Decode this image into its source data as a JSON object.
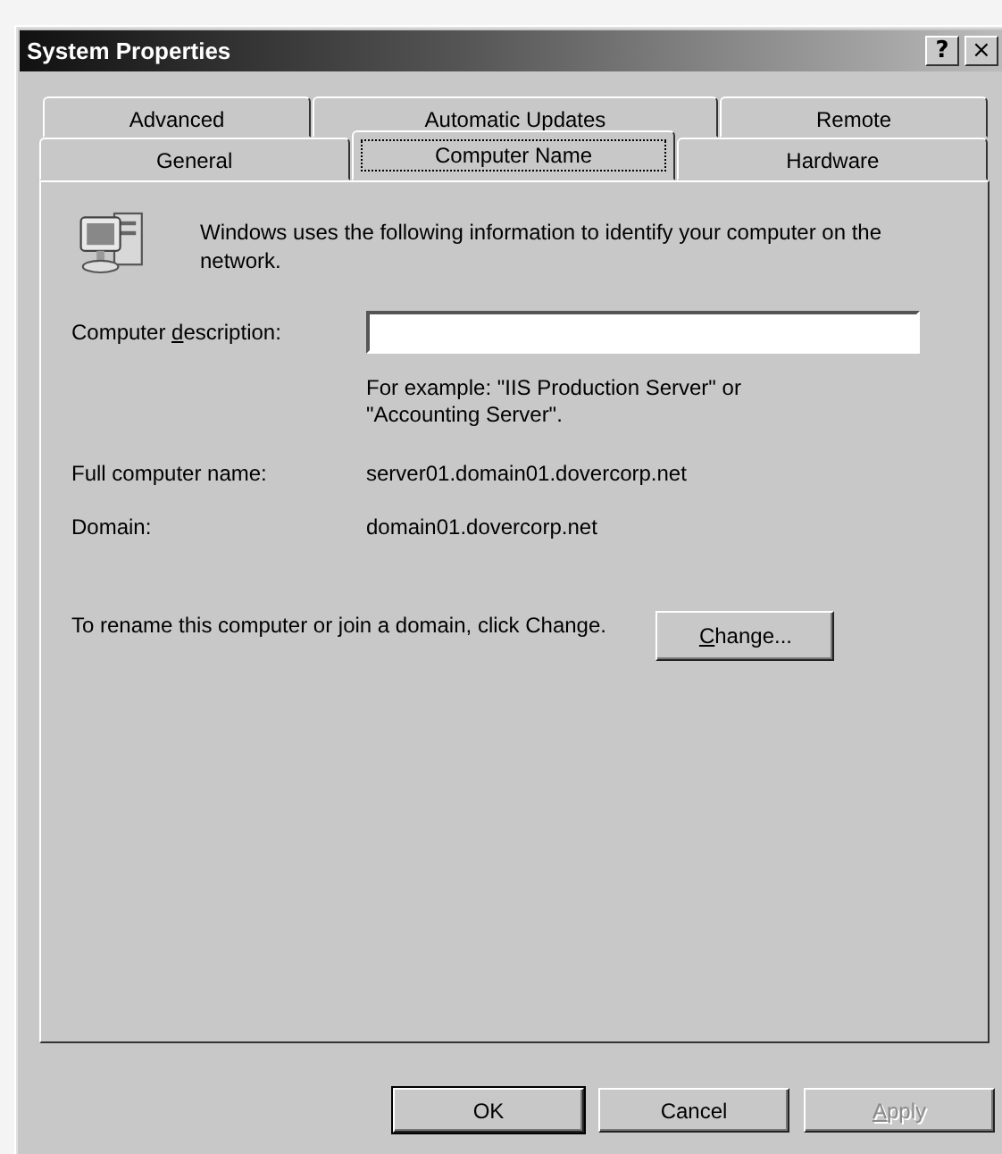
{
  "window": {
    "title": "System Properties",
    "title_buttons": [
      {
        "kind": "help",
        "glyph": "?"
      },
      {
        "kind": "close",
        "glyph": "×"
      }
    ]
  },
  "tab_rows": [
    [
      {
        "label": "Advanced",
        "selected": false
      },
      {
        "label": "Automatic Updates",
        "selected": false
      },
      {
        "label": "Remote",
        "selected": false
      }
    ],
    [
      {
        "label": "General",
        "selected": false
      },
      {
        "label": "Computer Name",
        "selected": true
      },
      {
        "label": "Hardware",
        "selected": false
      }
    ]
  ],
  "intro": "Windows uses the following information to identify your computer on the network.",
  "description_field": {
    "label": {
      "before": "Computer ",
      "key": "d",
      "after": "escription:"
    }
  },
  "example": "For example: \"IIS Production Server\" or \"Accounting Server\".",
  "fields": [
    {
      "label": "Full computer name:",
      "value": "server01.domain01.dovercorp.net"
    },
    {
      "label": "Domain:",
      "value": "domain01.dovercorp.net"
    }
  ],
  "rename_text": "To rename this computer or join a domain, click Change.",
  "change_button": {
    "key": "C",
    "after": "hange..."
  },
  "buttons": [
    {
      "label": {
        "before": "OK"
      },
      "default": true,
      "disabled": false
    },
    {
      "label": {
        "before": "Cancel"
      },
      "default": false,
      "disabled": false
    },
    {
      "label": {
        "key": "A",
        "after": "pply"
      },
      "default": false,
      "disabled": true
    }
  ]
}
